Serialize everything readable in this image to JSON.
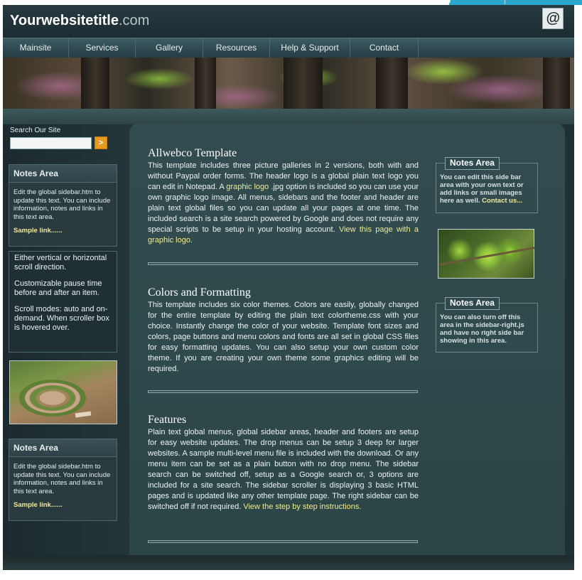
{
  "header": {
    "site_title_bold": "Yourwebsitetitle",
    "site_title_suffix": ".com",
    "email_button": "@"
  },
  "nav": {
    "items": [
      "Mainsite",
      "Services",
      "Gallery",
      "Resources",
      "Help & Support",
      "Contact"
    ]
  },
  "left_sidebar": {
    "search_label": "Search Our Site",
    "search_placeholder": "",
    "search_button": ">",
    "notes_top": {
      "title": "Notes Area",
      "body": "Edit the global sidebar.htm to update this text. You can include information, notes and links in this text area.",
      "link": "Sample link......"
    },
    "scroller": [
      "Either vertical or horizontal scroll direction.",
      "Customizable pause time before and after an item.",
      "Scroll modes: auto and on-demand. When scroller box is hovered over."
    ],
    "notes_bottom": {
      "title": "Notes Area",
      "body": "Edit the global sidebar.htm to update this text. You can include information, notes and links in this text area.",
      "link": "Sample link......"
    }
  },
  "main": {
    "articles": [
      {
        "title": "Allwebco Template",
        "text_a": "This template includes three picture galleries in 2 versions, both with and without Paypal order forms. The header logo is a global plain text logo you can edit in Notepad. A ",
        "link_a": "graphic logo",
        "text_b": " .jpg option is included so you can use your own graphic logo image. All menus, sidebars and the footer and header are plain text global files so you can update all your pages at one time. The included search is a site search powered by Google and does not require any special scripts to be setup in your hosting account. ",
        "link_b": "View this page with a graphic logo."
      },
      {
        "title": "Colors and Formatting",
        "text_a": "This template includes six color themes. Colors are easily, globally changed for the entire template by editing the plain text colortheme.css with your choice. Instantly change the color of your website. Template font sizes and colors, page buttons and menu colors and fonts are all set in global CSS files for easy formatting updates. You can also setup your own custom color theme. If you are creating your own theme some graphics editing will be required."
      },
      {
        "title": "Features",
        "text_a": "Plain text global menus, global sidebar areas, header and footers are setup for easy website updates. The drop menus can be setup 3 deep for larger websites. A sample multi-level menu file is included with the download. Or any menu item can be set as a plain button with no drop menu. The sidebar search can be switched off, setup as a Google search or, 3 options are included for a site search. The sidebar scroller is displaying 3 basic HTML pages and is updated like any other template page. The right sidebar can be switched off if not required. ",
        "link_a": "View the step by step instructions."
      }
    ]
  },
  "right_sidebar": {
    "note1": {
      "title": "Notes Area",
      "body": "You can edit this side bar area with your own text or add links or small images here as well. ",
      "link": "Contact us..."
    },
    "note2": {
      "title": "Notes Area",
      "body": "You can also turn off this area in the sidebar-right.js and have no right side bar showing in this area."
    }
  },
  "colors": {
    "link": "#f2ea8c",
    "accent_orange": "#e69a1f",
    "top_strip": "#2aa7cf"
  }
}
